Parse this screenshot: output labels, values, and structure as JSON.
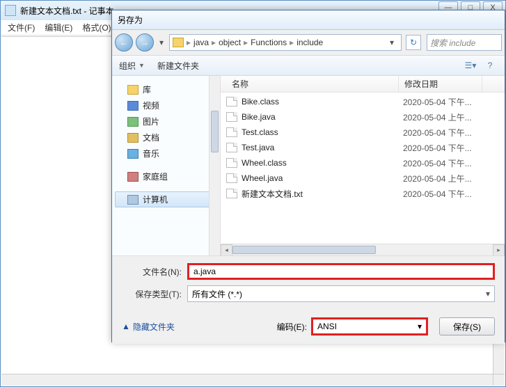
{
  "notepad": {
    "title": "新建文本文档.txt - 记事本",
    "menu": [
      "文件(F)",
      "编辑(E)",
      "格式(O)"
    ],
    "controls": {
      "min": "—",
      "max": "□",
      "close": "X"
    }
  },
  "saveas": {
    "title": "另存为",
    "nav_back": "←",
    "nav_fwd": "→",
    "breadcrumb": [
      "java",
      "object",
      "Functions",
      "include"
    ],
    "sep": "▸",
    "refresh": "↻",
    "search_placeholder": "搜索 include",
    "toolbar": {
      "organize": "组织",
      "newfolder": "新建文件夹"
    },
    "tree": {
      "library": "库",
      "videos": "视频",
      "pictures": "图片",
      "documents": "文档",
      "music": "音乐",
      "homegroup": "家庭组",
      "computer": "计算机"
    },
    "columns": {
      "name": "名称",
      "date": "修改日期"
    },
    "files": [
      {
        "name": "Bike.class",
        "date": "2020-05-04 下午..."
      },
      {
        "name": "Bike.java",
        "date": "2020-05-04 上午..."
      },
      {
        "name": "Test.class",
        "date": "2020-05-04 下午..."
      },
      {
        "name": "Test.java",
        "date": "2020-05-04 下午..."
      },
      {
        "name": "Wheel.class",
        "date": "2020-05-04 下午..."
      },
      {
        "name": "Wheel.java",
        "date": "2020-05-04 上午..."
      },
      {
        "name": "新建文本文档.txt",
        "date": "2020-05-04 下午..."
      }
    ],
    "labels": {
      "filename": "文件名(N):",
      "type": "保存类型(T):",
      "encoding": "编码(E):"
    },
    "filename_value": "a.java",
    "type_value": "所有文件 (*.*)",
    "encoding_value": "ANSI",
    "hide_folders": "隐藏文件夹",
    "save_btn": "保存(S)"
  }
}
